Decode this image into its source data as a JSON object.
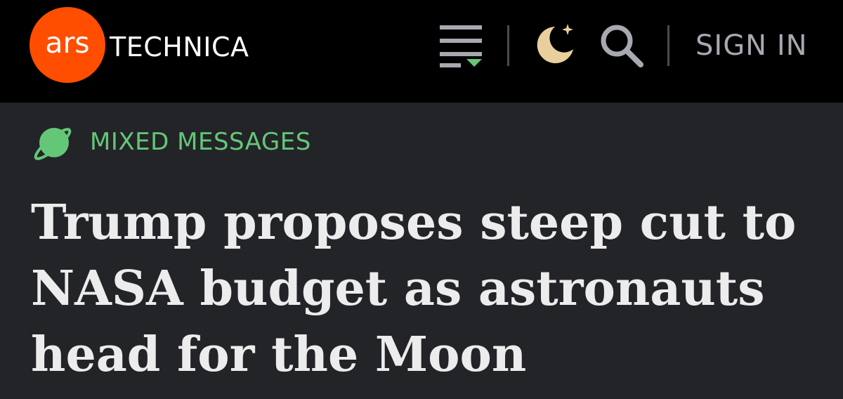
{
  "header": {
    "logo": {
      "ars": "ars",
      "wordmark": "TECHNICA"
    },
    "icons": {
      "menu": "menu-icon",
      "theme": "moon-icon",
      "search": "search-icon"
    },
    "sign_in_label": "SIGN IN"
  },
  "article": {
    "section_icon": "planet-icon",
    "section_label": "MIXED MESSAGES",
    "headline_lines": [
      "Trump proposes steep cut to",
      "NASA budget as astronauts",
      "head for the Moon"
    ]
  },
  "colors": {
    "logo_orange": "#ff4e00",
    "section_green": "#64c778",
    "header_bg": "#000000",
    "page_bg": "#232427",
    "moon_tan": "#e8cf9c"
  }
}
